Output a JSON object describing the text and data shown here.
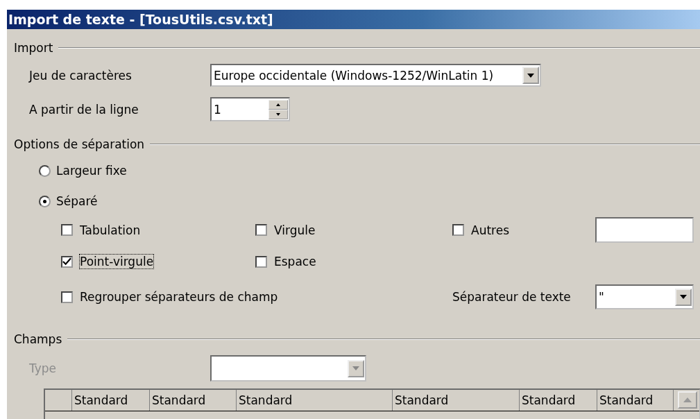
{
  "window": {
    "title": "Import de texte - [TousUtils.csv.txt]"
  },
  "import": {
    "title": "Import",
    "charset": {
      "label": "Jeu de caractères",
      "value": "Europe occidentale (Windows-1252/WinLatin 1)"
    },
    "from_line": {
      "label": "A partir de la ligne",
      "value": "1"
    }
  },
  "separation": {
    "title": "Options de séparation",
    "modes": [
      {
        "label": "Largeur fixe",
        "selected": false
      },
      {
        "label": "Séparé",
        "selected": true
      }
    ],
    "separators": [
      {
        "label": "Tabulation",
        "checked": false
      },
      {
        "label": "Virgule",
        "checked": false
      },
      {
        "label": "Autres",
        "checked": false
      },
      {
        "label": "Point-virgule",
        "checked": true
      },
      {
        "label": "Espace",
        "checked": false
      }
    ],
    "merge": {
      "label": "Regrouper séparateurs de champ",
      "checked": false
    },
    "text_separator": {
      "label": "Séparateur de texte",
      "value": "\""
    }
  },
  "fields": {
    "title": "Champs",
    "type": {
      "label": "Type",
      "disabled": true
    },
    "columns": [
      "Standard",
      "Standard",
      "Standard",
      "Standard",
      "Standard",
      "Standard"
    ]
  }
}
